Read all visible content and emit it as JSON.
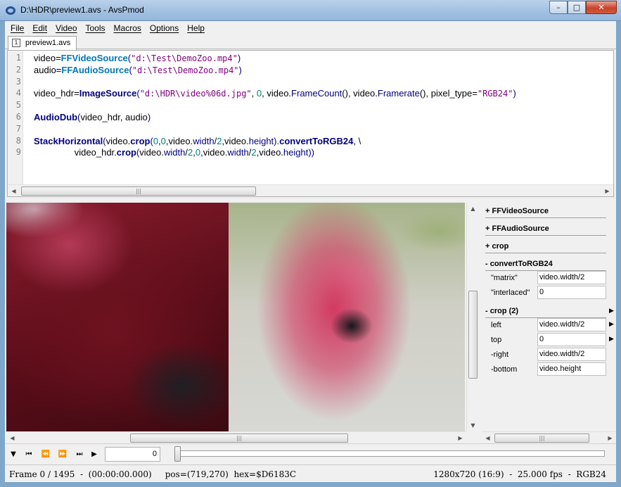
{
  "window": {
    "title": "D:\\HDR\\preview1.avs - AvsPmod",
    "minimize_glyph": "–",
    "maximize_glyph": "□",
    "close_glyph": "✕"
  },
  "menu": [
    "File",
    "Edit",
    "Video",
    "Tools",
    "Macros",
    "Options",
    "Help"
  ],
  "tab": {
    "label": "preview1.avs",
    "icon_glyph": "1"
  },
  "editor": {
    "line_numbers": [
      "1",
      "2",
      "3",
      "4",
      "5",
      "6",
      "7",
      "8",
      "9"
    ],
    "lines": [
      [
        [
          "",
          "video="
        ],
        [
          "fn",
          "FFVideoSource"
        ],
        [
          "op",
          "("
        ],
        [
          "str",
          "\"d:\\Test\\DemoZoo.mp4\""
        ],
        [
          "op",
          ")"
        ]
      ],
      [
        [
          "",
          "audio="
        ],
        [
          "fn",
          "FFAudioSource"
        ],
        [
          "op",
          "("
        ],
        [
          "str",
          "\"d:\\Test\\DemoZoo.mp4\""
        ],
        [
          "op",
          ")"
        ]
      ],
      [],
      [
        [
          "",
          "video_hdr="
        ],
        [
          "kw",
          "ImageSource"
        ],
        [
          "op",
          "("
        ],
        [
          "str",
          "\"d:\\HDR\\video%06d.jpg\""
        ],
        [
          "",
          ", "
        ],
        [
          "num",
          "0"
        ],
        [
          "",
          ", video."
        ],
        [
          "meth",
          "FrameCount"
        ],
        [
          "",
          "(), video."
        ],
        [
          "meth",
          "Framerate"
        ],
        [
          "",
          "(), pixel_type="
        ],
        [
          "str",
          "\"RGB24\""
        ],
        [
          "op",
          ")"
        ]
      ],
      [],
      [
        [
          "",
          ""
        ],
        [
          "kw",
          "AudioDub"
        ],
        [
          "op",
          "("
        ],
        [
          "",
          "video_hdr, audio"
        ],
        [
          "op",
          ")"
        ]
      ],
      [],
      [
        [
          "",
          ""
        ],
        [
          "kw",
          "StackHorizontal"
        ],
        [
          "op",
          "("
        ],
        [
          "",
          "video."
        ],
        [
          "kw",
          "crop"
        ],
        [
          "op",
          "("
        ],
        [
          "num",
          "0"
        ],
        [
          "",
          ","
        ],
        [
          "num",
          "0"
        ],
        [
          "",
          ",video."
        ],
        [
          "meth",
          "width"
        ],
        [
          "",
          "/"
        ],
        [
          "num",
          "2"
        ],
        [
          "",
          ",video."
        ],
        [
          "meth",
          "height"
        ],
        [
          "op",
          ")"
        ],
        [
          "",
          "."
        ],
        [
          "kw",
          "convertToRGB24"
        ],
        [
          "",
          ", \\"
        ]
      ],
      [
        [
          "",
          "                video_hdr."
        ],
        [
          "kw",
          "crop"
        ],
        [
          "op",
          "("
        ],
        [
          "",
          "video."
        ],
        [
          "meth",
          "width"
        ],
        [
          "",
          "/"
        ],
        [
          "num",
          "2"
        ],
        [
          "",
          ","
        ],
        [
          "num",
          "0"
        ],
        [
          "",
          ",video."
        ],
        [
          "meth",
          "width"
        ],
        [
          "",
          "/"
        ],
        [
          "num",
          "2"
        ],
        [
          "",
          ",video."
        ],
        [
          "meth",
          "height"
        ],
        [
          "op",
          "))"
        ]
      ]
    ]
  },
  "side_panel": {
    "groups": [
      {
        "header": "+ FFVideoSource"
      },
      {
        "header": "+ FFAudioSource"
      },
      {
        "header": "+ crop"
      },
      {
        "header": "- convertToRGB24",
        "args": [
          {
            "label": "\"matrix\"",
            "value": "video.width/2"
          },
          {
            "label": "\"interlaced\"",
            "value": "0"
          }
        ]
      },
      {
        "header": "- crop (2)",
        "args": [
          {
            "label": "left",
            "value": "video.width/2"
          },
          {
            "label": "top",
            "value": "0"
          },
          {
            "label": "-right",
            "value": "video.width/2"
          },
          {
            "label": "-bottom",
            "value": "video.height"
          }
        ]
      }
    ]
  },
  "playback": {
    "buttons": [
      "play-dropdown",
      "first-frame",
      "prev-frame",
      "next-frame",
      "last-frame",
      "play"
    ],
    "glyphs": [
      "▼",
      "⏮",
      "⏪",
      "⏩",
      "⏭",
      "▶"
    ],
    "frame_value": "0",
    "position_fraction": 0
  },
  "status": {
    "left": "Frame 0 / 1495  -  (00:00:00.000)     pos=(719,270)  hex=$D6183C",
    "right": "1280x720 (16:9)  -  25.000 fps  -  RGB24"
  },
  "scroll_glyphs": {
    "left": "◀",
    "right": "▶",
    "up": "▲",
    "down": "▼",
    "grip": "|||"
  }
}
